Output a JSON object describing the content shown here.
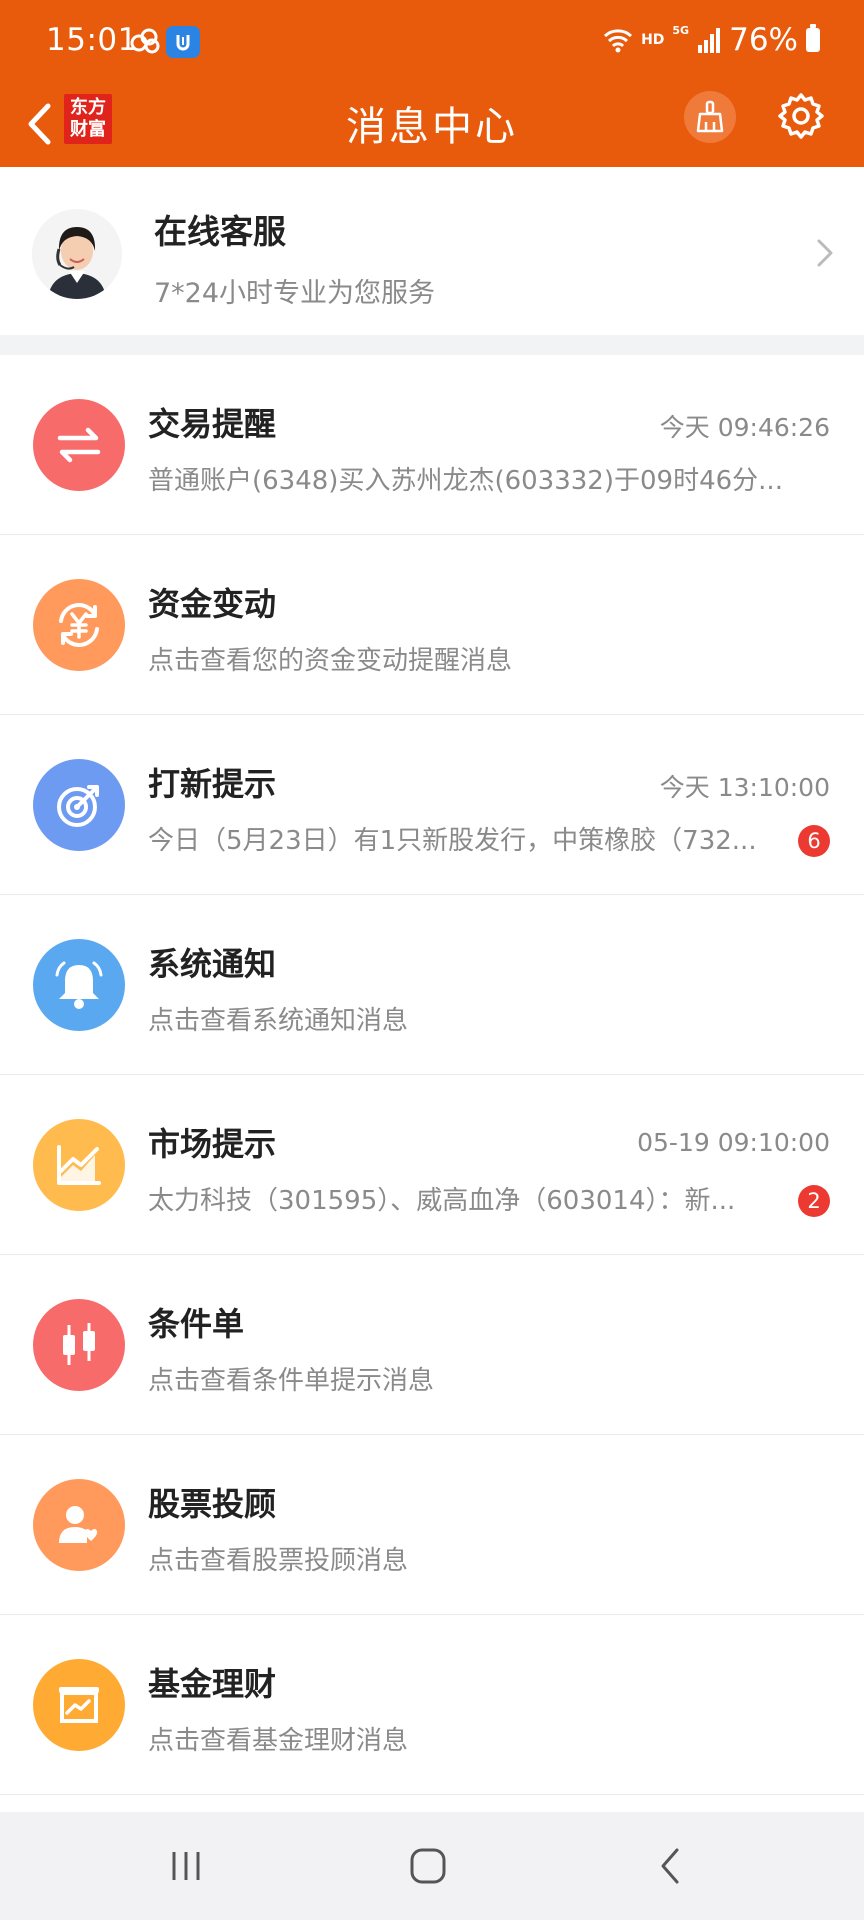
{
  "status_bar": {
    "time": "15:01",
    "battery": "76%",
    "network_hd": "HD",
    "network_5g": "5G"
  },
  "header": {
    "title": "消息中心",
    "logo_line1": "东方",
    "logo_line2": "财富",
    "accent_color": "#E85A0C"
  },
  "service": {
    "title": "在线客服",
    "subtitle": "7*24小时专业为您服务"
  },
  "messages": [
    {
      "title": "交易提醒",
      "time": "今天 09:46:26",
      "subtitle": "普通账户(6348)买入苏州龙杰(603332)于09时46分...",
      "badge": "",
      "icon": "exchange-icon",
      "color": "#F76B6B"
    },
    {
      "title": "资金变动",
      "time": "",
      "subtitle": "点击查看您的资金变动提醒消息",
      "badge": "",
      "icon": "yuan-cycle-icon",
      "color": "#FF9A5C"
    },
    {
      "title": "打新提示",
      "time": "今天 13:10:00",
      "subtitle": "今日（5月23日）有1只新股发行，中策橡胶（732...",
      "badge": "6",
      "icon": "target-icon",
      "color": "#6E9BF2"
    },
    {
      "title": "系统通知",
      "time": "",
      "subtitle": "点击查看系统通知消息",
      "badge": "",
      "icon": "bell-icon",
      "color": "#5AA9F0"
    },
    {
      "title": "市场提示",
      "time": "05-19 09:10:00",
      "subtitle": "太力科技（301595）、威高血净（603014）：新...",
      "badge": "2",
      "icon": "trend-chart-icon",
      "color": "#FFBB4D"
    },
    {
      "title": "条件单",
      "time": "",
      "subtitle": "点击查看条件单提示消息",
      "badge": "",
      "icon": "candlestick-icon",
      "color": "#F76B6B"
    },
    {
      "title": "股票投顾",
      "time": "",
      "subtitle": "点击查看股票投顾消息",
      "badge": "",
      "icon": "advisor-icon",
      "color": "#FF9A5C"
    },
    {
      "title": "基金理财",
      "time": "",
      "subtitle": "点击查看基金理财消息",
      "badge": "",
      "icon": "fund-board-icon",
      "color": "#FFAA33"
    }
  ]
}
